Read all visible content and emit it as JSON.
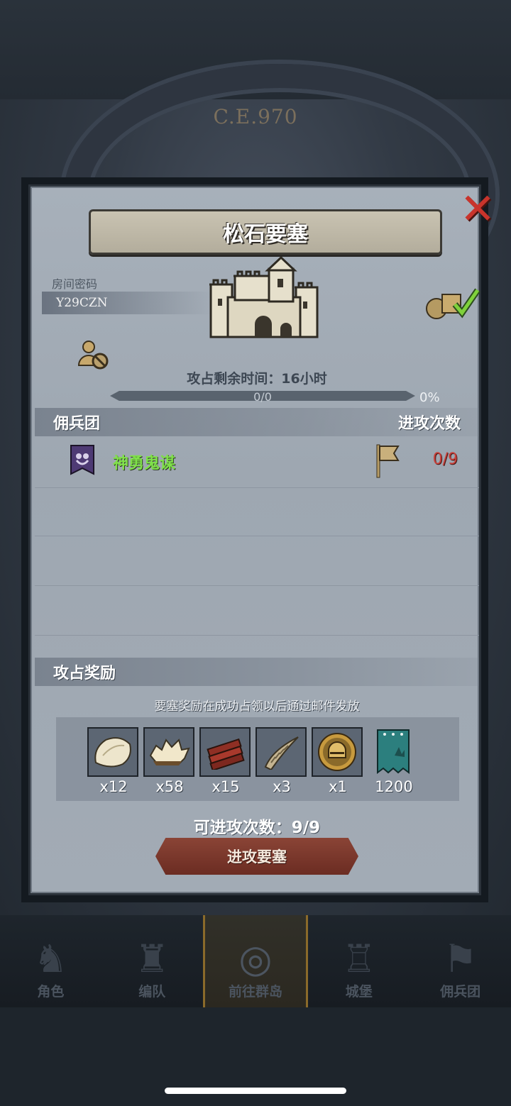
{
  "background": {
    "year_label": "C.E.970"
  },
  "modal": {
    "title": "松石要塞",
    "close_icon": "close-x-icon",
    "room": {
      "label": "房间密码",
      "code": "Y29CZN"
    },
    "timer_text": "攻占剩余时间：16小时",
    "progress": {
      "text": "0/0",
      "percent_text": "0%",
      "fraction": 0
    },
    "mercenary_section": {
      "left_header": "佣兵团",
      "right_header": "进攻次数",
      "rows": [
        {
          "emblem_icon": "owl-banner-icon",
          "name": "神勇鬼谋",
          "flag_icon": "flag-icon",
          "count": "0/9"
        }
      ]
    },
    "reward_section": {
      "header": "攻占奖励",
      "notice": "要塞奖励在成功占领以后通过邮件发放",
      "items": [
        {
          "icon": "fur-pelt-icon",
          "qty": "x12"
        },
        {
          "icon": "wool-fleece-icon",
          "qty": "x58"
        },
        {
          "icon": "wood-planks-icon",
          "qty": "x15"
        },
        {
          "icon": "horn-icon",
          "qty": "x3"
        },
        {
          "icon": "helmet-medal-icon",
          "qty": "x1"
        },
        {
          "icon": "guild-banner-icon",
          "qty": "1200"
        }
      ]
    },
    "available_attacks": "可进攻次数：9/9",
    "attack_button": "进攻要塞"
  },
  "bottom_nav": {
    "items": [
      {
        "icon": "knight-icon",
        "label": "角色"
      },
      {
        "icon": "armor-icon",
        "label": "编队"
      },
      {
        "icon": "globe-compass-icon",
        "label": "前往群岛"
      },
      {
        "icon": "castle-icon",
        "label": "城堡"
      },
      {
        "icon": "mercenary-icon",
        "label": "佣兵团"
      }
    ],
    "active_index": 2
  }
}
